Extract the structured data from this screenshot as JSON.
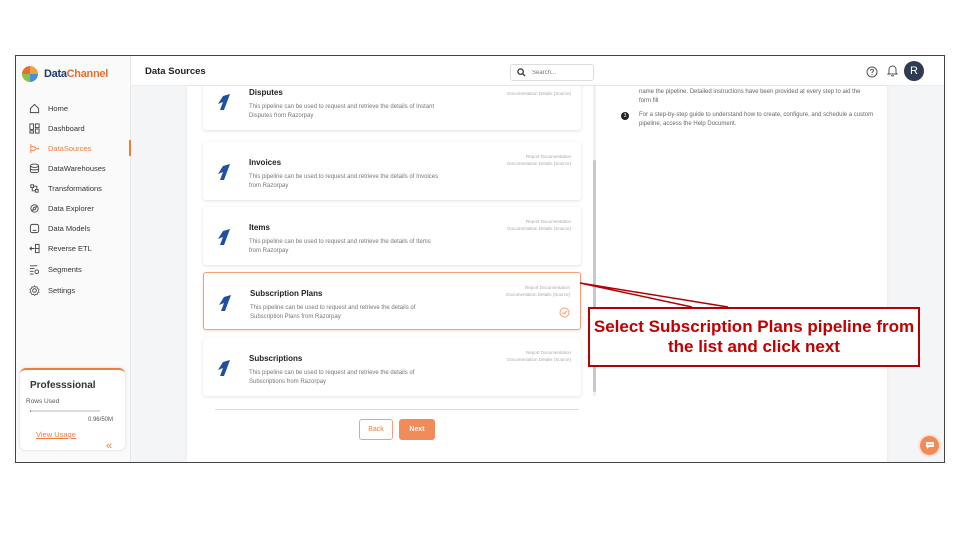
{
  "app": {
    "logo_part1": "Data",
    "logo_part2": "Channel"
  },
  "header": {
    "title": "Data Sources",
    "search_placeholder": "Search...",
    "avatar_initial": "R"
  },
  "sidebar": {
    "items": [
      {
        "label": "Home",
        "icon": "home-icon"
      },
      {
        "label": "Dashboard",
        "icon": "dashboard-icon"
      },
      {
        "label": "DataSources",
        "icon": "datasources-icon",
        "active": true
      },
      {
        "label": "DataWarehouses",
        "icon": "database-icon"
      },
      {
        "label": "Transformations",
        "icon": "transform-icon"
      },
      {
        "label": "Data Explorer",
        "icon": "explorer-icon"
      },
      {
        "label": "Data Models",
        "icon": "models-icon"
      },
      {
        "label": "Reverse ETL",
        "icon": "reverse-etl-icon"
      },
      {
        "label": "Segments",
        "icon": "segments-icon"
      },
      {
        "label": "Settings",
        "icon": "settings-icon"
      }
    ],
    "plan": {
      "name": "Professsional",
      "rows_label": "Rows Used",
      "rows_value": "0.96/50M",
      "rows_fraction": 0.02,
      "view_usage": "View Usage"
    }
  },
  "pipelines": [
    {
      "name": "Disputes",
      "desc": "This pipeline can be used to request and retrieve the details of Instant Disputes from Razorpay",
      "doc1": "",
      "doc2": "Documentation Details (Source)"
    },
    {
      "name": "Invoices",
      "desc": "This pipeline can be used to request and retrieve the details of Invoices from Razorpay",
      "doc1": "Report Documentation",
      "doc2": "Documentation Details (Source)"
    },
    {
      "name": "Items",
      "desc": "This pipeline can be used to request and retrieve the details of Items from Razorpay",
      "doc1": "Report Documentation",
      "doc2": "Documentation Details (Source)"
    },
    {
      "name": "Subscription Plans",
      "desc": "This pipeline can be used to request and retrieve the details of Subscription Plans from Razorpay",
      "doc1": "Report Documentation",
      "doc2": "Documentation Details (Source)",
      "selected": true
    },
    {
      "name": "Subscriptions",
      "desc": "This pipeline can be used to request and retrieve the details of Subscriptions from Razorpay",
      "doc1": "Report Documentation",
      "doc2": "Documentation Details (Source)"
    }
  ],
  "buttons": {
    "back": "Back",
    "next": "Next"
  },
  "info": {
    "text1": "name the pipeline. Detailed instructions have been provided at every step to aid the form fill",
    "step3_number": "3",
    "text2": "For a step-by-step guide to understand how to create, configure, and schedule a custom pipeline, access the Help Document."
  },
  "callout": {
    "text": "Select Subscription Plans pipeline from the list and click next"
  },
  "colors": {
    "accent": "#f07b3f",
    "callout_red": "#c00000",
    "brand_navy": "#1f3a6e"
  }
}
